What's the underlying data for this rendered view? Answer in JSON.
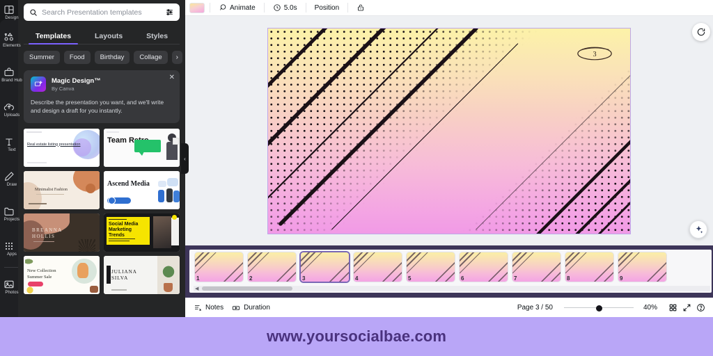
{
  "rail": {
    "items": [
      {
        "label": "Design",
        "icon": "design-icon"
      },
      {
        "label": "Elements",
        "icon": "elements-icon"
      },
      {
        "label": "Brand Hub",
        "icon": "brand-hub-icon"
      },
      {
        "label": "Uploads",
        "icon": "uploads-icon"
      },
      {
        "label": "Text",
        "icon": "text-icon"
      },
      {
        "label": "Draw",
        "icon": "draw-icon"
      },
      {
        "label": "Projects",
        "icon": "projects-icon"
      },
      {
        "label": "Apps",
        "icon": "apps-icon"
      },
      {
        "label": "Photos",
        "icon": "photos-icon"
      }
    ]
  },
  "panel": {
    "search": {
      "placeholder": "Search Presentation templates",
      "value": "",
      "icon": "search-icon",
      "filter_icon": "filter-sliders-icon"
    },
    "tabs": [
      {
        "label": "Templates",
        "active": true
      },
      {
        "label": "Layouts",
        "active": false
      },
      {
        "label": "Styles",
        "active": false
      }
    ],
    "chips": [
      "Summer",
      "Food",
      "Birthday",
      "Collage"
    ],
    "chip_next_label": "›",
    "magic_card": {
      "title": "Magic Design™",
      "subtitle": "By Canva",
      "body": "Describe the presentation you want, and we'll write and design a draft for you instantly.",
      "close_label": "✕"
    },
    "templates": [
      {
        "name": "Real estate listing presentation",
        "kicker": "",
        "style": "realestate"
      },
      {
        "name": "Team Retro",
        "kicker": "",
        "style": "teamretro"
      },
      {
        "name": "Minimalist Fashion",
        "kicker": "",
        "style": "fashion"
      },
      {
        "name": "Ascend Media",
        "kicker": "",
        "style": "ascend"
      },
      {
        "name": "BREANNA HOLLIS",
        "kicker": "",
        "style": "breanna"
      },
      {
        "name": "Social Media Marketing Trends",
        "kicker": "",
        "style": "socialmedia"
      },
      {
        "name": "New Collection Summer Sale",
        "kicker": "",
        "style": "summersale"
      },
      {
        "name": "JULIANA SILVA",
        "kicker": "",
        "style": "juliana"
      }
    ],
    "collapse_handle_label": "‹"
  },
  "toolbar": {
    "color_swatch_name": "gradient-swatch",
    "animate_label": "Animate",
    "duration_label": "5.0s",
    "position_label": "Position",
    "lock_icon": "lock-icon"
  },
  "canvas": {
    "slide_page_marker": "3",
    "regenerate_icon": "refresh-icon",
    "magic_fab_icon": "sparkle-icon"
  },
  "filmstrip": {
    "slides": [
      {
        "number": "1",
        "selected": false
      },
      {
        "number": "2",
        "selected": false
      },
      {
        "number": "3",
        "selected": true
      },
      {
        "number": "4",
        "selected": false
      },
      {
        "number": "5",
        "selected": false
      },
      {
        "number": "6",
        "selected": false
      },
      {
        "number": "7",
        "selected": false
      },
      {
        "number": "8",
        "selected": false
      },
      {
        "number": "9",
        "selected": false
      }
    ],
    "scroll_arrow_label": "◀"
  },
  "statusbar": {
    "notes_label": "Notes",
    "notes_icon": "notes-icon",
    "duration_label": "Duration",
    "duration_icon": "timeline-icon",
    "page_indicator": "Page 3 / 50",
    "zoom_level": "40%",
    "grid_icon": "grid-view-icon",
    "expand_icon": "fullscreen-icon",
    "help_icon": "help-icon"
  },
  "watermark": {
    "text": "www.yoursocialbae.com"
  },
  "colors": {
    "accent_purple": "#7b61ff",
    "watermark_bg": "#b9a6f7",
    "watermark_fg": "#4a327e",
    "filmstrip_bg": "#3d3559",
    "panel_bg": "#252627",
    "rail_bg": "#18191b"
  }
}
